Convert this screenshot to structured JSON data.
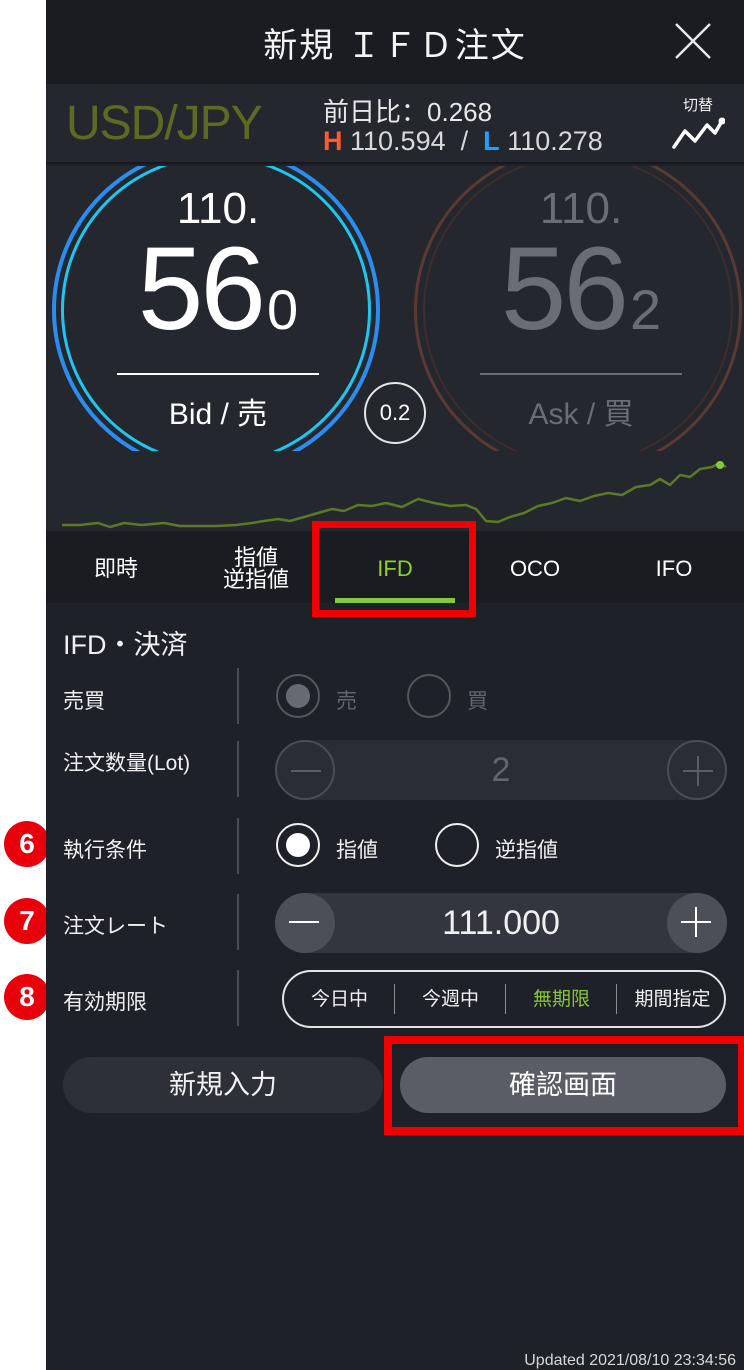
{
  "header": {
    "title": "新規 ＩＦＤ注文"
  },
  "pair": {
    "name": "USD/JPY",
    "diff_label": "前日比：",
    "diff_value": "0.268",
    "high_label": "H",
    "high_value": "110.594",
    "separator": "/",
    "low_label": "L",
    "low_value": "110.278",
    "switch_label": "切替"
  },
  "bid": {
    "top": "110.",
    "main": "56",
    "small": "0",
    "label": "Bid / 売"
  },
  "ask": {
    "top": "110.",
    "main": "56",
    "small": "2",
    "label": "Ask / 買"
  },
  "spread": "0.2",
  "tabs": [
    {
      "label": "即時"
    },
    {
      "label1": "指値",
      "label2": "逆指値"
    },
    {
      "label": "IFD"
    },
    {
      "label": "OCO"
    },
    {
      "label": "IFO"
    }
  ],
  "form": {
    "section_title": "IFD・決済",
    "side": {
      "label": "売買",
      "sell": "売",
      "buy": "買"
    },
    "quantity": {
      "label": "注文数量(Lot)",
      "value": "2"
    },
    "condition": {
      "label": "執行条件",
      "limit": "指値",
      "stop": "逆指値"
    },
    "rate": {
      "label": "注文レート",
      "value": "111.000"
    },
    "expiry": {
      "label": "有効期限",
      "options": [
        "今日中",
        "今週中",
        "無期限",
        "期間指定"
      ],
      "selected": "無期限"
    }
  },
  "buttons": {
    "new_input": "新規入力",
    "confirm": "確認画面"
  },
  "updated": "Updated  2021/08/10 23:34:56",
  "badges": [
    "6",
    "7",
    "8"
  ],
  "colors": {
    "accent_green": "#87c534",
    "highlight_red": "#f00000",
    "high": "#ff5a2c",
    "low": "#1ea0ff"
  }
}
